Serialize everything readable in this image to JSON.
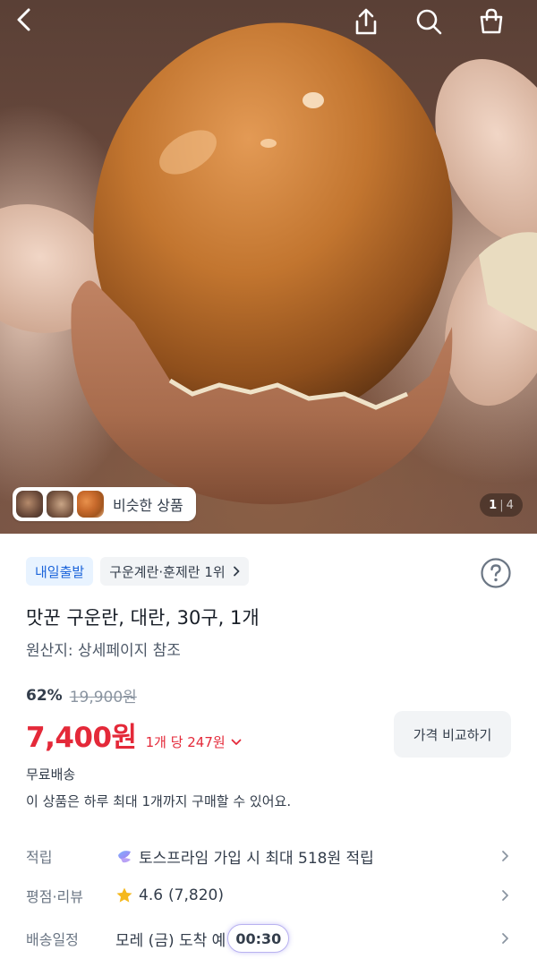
{
  "header": {
    "icons": [
      "back-icon",
      "share-icon",
      "search-icon",
      "shopping-bag-icon"
    ]
  },
  "gallery": {
    "similar_label": "비슷한 상품",
    "current_page": "1",
    "total_pages": "4"
  },
  "tags": {
    "delivery_tag": "내일출발",
    "ranking_tag": "구운계란·훈제란 1위"
  },
  "product": {
    "name": "맛꾼 구운란, 대란, 30구, 1개",
    "origin": "원산지: 상세페이지 참조"
  },
  "pricing": {
    "discount_rate": "62%",
    "original_price": "19,900원",
    "price": "7,400원",
    "unit_price": "1개 당 247원",
    "compare_button": "가격 비교하기"
  },
  "shipping": {
    "label": "무료배송",
    "limit_notice": "이 상품은 하루 최대 1개까지 구매할 수 있어요."
  },
  "details": {
    "points_label": "적립",
    "points_value": "토스프라임 가입 시 최대 518원 적립",
    "rating_label": "평점·리뷰",
    "rating_value": "4.6",
    "review_count": "(7,820)",
    "delivery_label": "배송일정",
    "delivery_value": "모레 (금) 도착 예",
    "timer": "00:30"
  },
  "colors": {
    "accent_red": "#e42939",
    "accent_blue": "#1b64da",
    "star": "#f5b81c"
  }
}
